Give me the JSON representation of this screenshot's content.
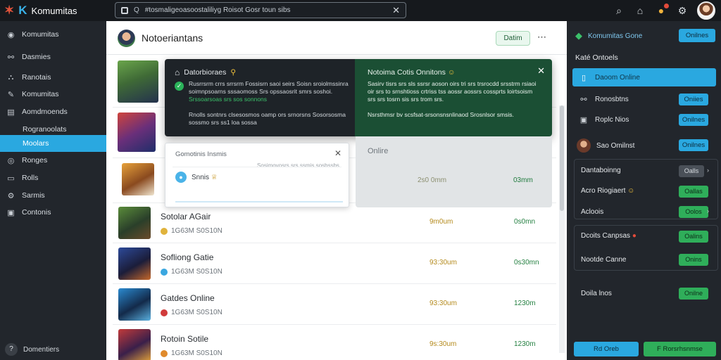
{
  "topbar": {
    "brand": "Komumitas",
    "search_value": "#tosmaligeoasoostaliliyg Roisot Gosr toun sibs",
    "search_prefix": "Q"
  },
  "sidebar": {
    "items": [
      {
        "label": "Komumitas",
        "icon": "home-icon",
        "glyph": "◉"
      },
      {
        "label": "Dasmies",
        "icon": "link-icon",
        "glyph": "⚯"
      },
      {
        "label": "Ranotais",
        "icon": "network-icon",
        "glyph": "⛬"
      },
      {
        "label": "Komumitas",
        "icon": "tool-icon",
        "glyph": "✎"
      },
      {
        "label": "Aomdmoends",
        "icon": "list-icon",
        "glyph": "▤"
      },
      {
        "label": "Rogranoolats",
        "icon": "",
        "glyph": ""
      },
      {
        "label": "Moolars",
        "icon": "",
        "glyph": ""
      },
      {
        "label": "Ronges",
        "icon": "ring-icon",
        "glyph": "◎"
      },
      {
        "label": "Rolls",
        "icon": "chat-icon",
        "glyph": "▭"
      },
      {
        "label": "Sarmis",
        "icon": "gear-icon",
        "glyph": "⚙"
      },
      {
        "label": "Contonis",
        "icon": "card-icon",
        "glyph": "▣"
      }
    ],
    "bottom_label": "Domentiers",
    "bottom_glyph": "?"
  },
  "main": {
    "header_title": "Notoeriantans",
    "header_button": "Datim",
    "header_more": "⋯",
    "rows": [
      {
        "name": "Sotolar AGair",
        "sub": "1G63M S0S10N",
        "time": "9m0um",
        "status": "0s0mn",
        "dot": "#e0b33c"
      },
      {
        "name": "Sofliong Gatie",
        "sub": "1G63M S0S10N",
        "time": "93:30um",
        "status": "0s30mn",
        "dot": "#3aa7e0"
      },
      {
        "name": "Gatdes Online",
        "sub": "1G63M S0S10N",
        "time": "93:30um",
        "status": "1230m",
        "dot": "#d13b3b"
      },
      {
        "name": "Rotoin Sotile",
        "sub": "1G63M S0S10N",
        "time": "9s:30um",
        "status": "1230m",
        "dot": "#e08a2c"
      }
    ]
  },
  "popup": {
    "left_title": "Datorbioraes",
    "left_line1": "Rusrrsrm crrs srrsrm Fossisrn saoi seirs Soisn sroiolmssinra soimnpsoarns sssaomoss Srs opssaosrit smrs soshoi. ",
    "left_line1_green": "Srssoarsoas srs sos sonnons",
    "left_line2": "Rnolls sontnrs clsesosmos oamp ors srnorsns Sosorsosma sossmo srs ss1 loa sossa",
    "right_title": "Notoima Cotis Onnitons",
    "right_line1": "Sasirv tisrs srs sls ssrsr aoson oirs tri srs trsrocdd srsstrm rsiaoi oir srs to srnshtioss crtriss tss aossr aossrs cossprts loirtsoism srs srs tosrn sis srs trom srs.",
    "right_line2": "Nsrsthmsr bv scsfsat-srsonsnsnlinaod Srosnlsor smsis."
  },
  "card": {
    "title": "Gomotinis Insmis",
    "line": "Sosimovosrs srs ssmis sosbssbs",
    "name": "Snnis"
  },
  "grey_panel": {
    "title": "Onlire",
    "time": "2s0 0mm",
    "status": "03mm"
  },
  "rpanel": {
    "header_title": "Komumitas Gone",
    "header_button": "Onilnes",
    "section_title": "Katé Ontoels",
    "items": [
      {
        "label": "Daoom Online",
        "button": ""
      },
      {
        "label": "Ronosbtns",
        "button": "Oniies"
      },
      {
        "label": "Roplc Nios",
        "button": "Onilnes"
      }
    ],
    "user_label": "Sao Omilnst",
    "user_button": "Onilnes",
    "group1": [
      {
        "label": "Dantaboinng",
        "button": "Oalls"
      },
      {
        "label": "Acro Riogiaert",
        "button": "Oallas"
      },
      {
        "label": "Acloois",
        "button": "Oolos"
      }
    ],
    "group2": [
      {
        "label": "Dcoits Canpsas",
        "button": "Oalins"
      },
      {
        "label": "Nootde Canne",
        "button": "Onins"
      }
    ],
    "last_label": "Doila lnos",
    "last_button": "Onilne",
    "footer_blue": "Rd Oreb",
    "footer_green": "F Rorsrhsnmse"
  }
}
